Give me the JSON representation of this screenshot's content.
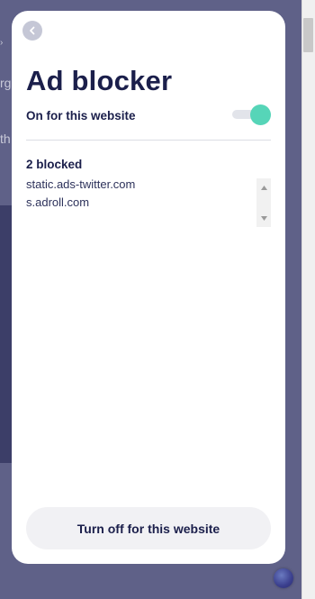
{
  "background": {
    "fragments": [
      "›",
      "rg",
      "th"
    ]
  },
  "panel": {
    "title": "Ad blocker",
    "status_label": "On for this website",
    "toggle_on": true,
    "blocked_count_label": "2 blocked",
    "blocked_domains": [
      "static.ads-twitter.com",
      "s.adroll.com"
    ],
    "turn_off_label": "Turn off for this website"
  },
  "icons": {
    "back": "chevron-left-icon",
    "scroll_up": "triangle-up-icon",
    "scroll_down": "triangle-down-icon"
  },
  "colors": {
    "accent": "#56d5b8",
    "title": "#1b1f4b",
    "overlay": "#5f6188"
  }
}
